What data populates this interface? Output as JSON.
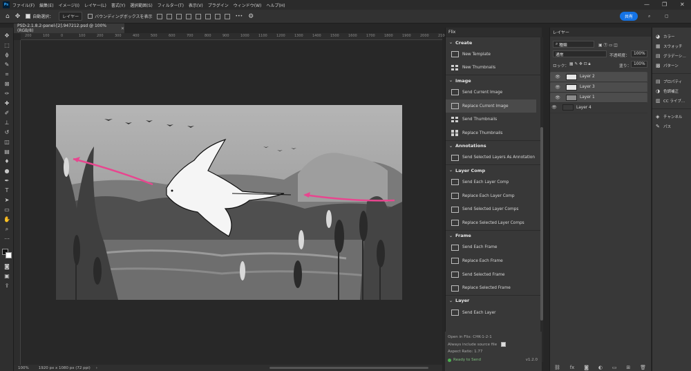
{
  "menu": {
    "app_icon": "Ps",
    "items": [
      "ファイル(F)",
      "編集(E)",
      "イメージ(I)",
      "レイヤー(L)",
      "書式(Y)",
      "選択範囲(S)",
      "フィルター(T)",
      "表示(V)",
      "プラグイン",
      "ウィンドウ(W)",
      "ヘルプ(H)"
    ]
  },
  "options": {
    "auto_select_label": "自動選択：",
    "auto_select_value": "レイヤー",
    "bounding_box_label": "バウンディングボックスを表示",
    "more": "•••",
    "share_label": "共有"
  },
  "document": {
    "tab_title": "PSD-2.1.8.2-panel-[2].947212.psd @ 100% (RGB/8)",
    "zoom": "100%",
    "dimensions": "1920 px x 1080 px (72 ppi)",
    "ruler_marks": [
      "200",
      "150",
      "100",
      "50",
      "0",
      "50",
      "100",
      "150",
      "200",
      "250",
      "300",
      "350",
      "400",
      "450",
      "500",
      "550",
      "600",
      "650",
      "700",
      "750",
      "800",
      "850",
      "900",
      "950",
      "1000",
      "1050",
      "1100",
      "1150",
      "1200",
      "1250",
      "1300",
      "1350",
      "1400",
      "1450",
      "1500",
      "1550",
      "1600",
      "1650",
      "1700",
      "1750",
      "1800",
      "1850",
      "1900",
      "1950",
      "2000",
      "2050",
      "2100"
    ]
  },
  "flix": {
    "panel_title": "Flix",
    "sections": [
      {
        "title": "Create",
        "items": [
          {
            "label": "New Template",
            "icon": "template-icon"
          },
          {
            "label": "New Thumbnails",
            "icon": "grid-icon"
          }
        ]
      },
      {
        "title": "Image",
        "items": [
          {
            "label": "Send Current Image",
            "icon": "image-icon"
          },
          {
            "label": "Replace Current Image",
            "icon": "image-icon"
          },
          {
            "label": "Send Thumbnails",
            "icon": "grid-icon"
          },
          {
            "label": "Replace Thumbnails",
            "icon": "grid-icon"
          }
        ]
      },
      {
        "title": "Annotations",
        "items": [
          {
            "label": "Send Selected Layers As Annotation",
            "icon": "annotation-icon"
          }
        ]
      },
      {
        "title": "Layer Comp",
        "items": [
          {
            "label": "Send Each Layer Comp",
            "icon": "layer-comp-icon"
          },
          {
            "label": "Replace Each Layer Comp",
            "icon": "layer-comp-icon"
          },
          {
            "label": "Send Selected Layer Comps",
            "icon": "layer-comp-icon"
          },
          {
            "label": "Replace Selected Layer Comps",
            "icon": "layer-comp-icon"
          }
        ]
      },
      {
        "title": "Frame",
        "items": [
          {
            "label": "Send Each Frame",
            "icon": "film-icon"
          },
          {
            "label": "Replace Each Frame",
            "icon": "film-icon"
          },
          {
            "label": "Send Selected Frame",
            "icon": "film-icon"
          },
          {
            "label": "Replace Selected Frame",
            "icon": "film-icon"
          }
        ]
      },
      {
        "title": "Layer",
        "items": [
          {
            "label": "Send Each Layer",
            "icon": "layers-icon"
          }
        ]
      }
    ],
    "open_in_flix": "Open in Flix: CHK-1-2-1",
    "always_include": "Always include source file",
    "aspect_ratio": "Aspect Ratio: 1.77",
    "status": "Ready to Send",
    "version": "v1.2.0",
    "status_color": "#4caf50"
  },
  "layers": {
    "panel_title": "レイヤー",
    "filter_kind": "種類",
    "blend_mode": "通常",
    "opacity_label": "不透明度：",
    "opacity_value": "100%",
    "lock_label": "ロック：",
    "fill_label": "塗り：",
    "fill_value": "100%",
    "items": [
      {
        "name": "Layer 2"
      },
      {
        "name": "Layer 3"
      },
      {
        "name": "Layer 1"
      },
      {
        "name": "Layer 4"
      }
    ]
  },
  "dock": {
    "group1": [
      "カラー",
      "スウォッチ",
      "グラデーシ…",
      "パターン"
    ],
    "group2": [
      "プロパティ",
      "色調補正",
      "CC ライブ…"
    ],
    "group3": [
      "チャンネル",
      "パス"
    ]
  },
  "colors": {
    "accent": "#1473e6",
    "arrow": "#e8468f"
  }
}
